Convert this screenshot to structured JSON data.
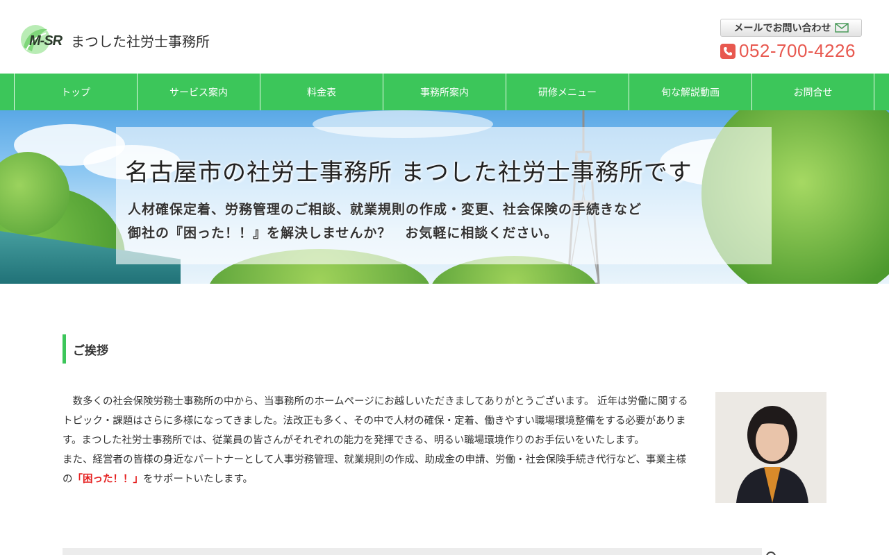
{
  "header": {
    "logo_mark": "M-SR",
    "logo_name": "まつした社労士事務所",
    "mail_button": "メールでお問い合わせ",
    "phone": "052-700-4226"
  },
  "nav": {
    "items": [
      {
        "label": "トップ"
      },
      {
        "label": "サービス案内"
      },
      {
        "label": "料金表"
      },
      {
        "label": "事務所案内"
      },
      {
        "label": "研修メニュー"
      },
      {
        "label": "旬な解説動画"
      },
      {
        "label": "お問合せ"
      }
    ]
  },
  "hero": {
    "title": "名古屋市の社労士事務所 まつした社労士事務所です",
    "sub1": "人材確保定着、労務管理のご相談、就業規則の作成・変更、社会保険の手続きなど",
    "sub2": "御社の『困った！！』を解決しませんか？　お気軽に相談ください。"
  },
  "greeting": {
    "heading": "ご挨拶",
    "para1": "　数多くの社会保険労務士事務所の中から、当事務所のホームページにお越しいただきましてありがとうございます。 近年は労働に関するトピック・課題はさらに多様になってきました。法改正も多く、その中で人材の確保・定着、働きやすい職場環境整備をする必要があります。まつした社労士事務所では、従業員の皆さんがそれぞれの能力を発揮できる、明るい職場環境作りのお手伝いをいたします。",
    "para2_before": "また、経営者の皆様の身近なパートナーとして人事労務管理、就業規則の作成、助成金の申請、労働・社会保険手続き代行など、事業主様の",
    "para2_highlight": "「困った！！」",
    "para2_after": "をサポートいたします。"
  },
  "colors": {
    "nav_green": "#3cc65a",
    "phone_red": "#e8584f",
    "highlight_red": "#e51f1f"
  }
}
